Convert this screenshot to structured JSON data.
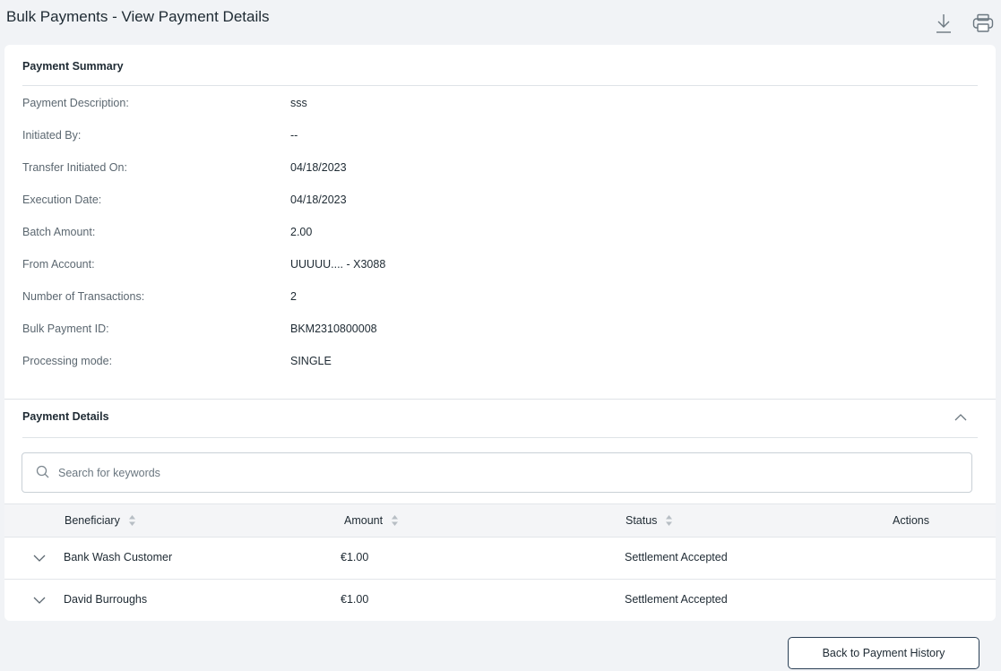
{
  "page": {
    "title": "Bulk Payments - View Payment Details",
    "icons": {
      "download": "download-icon",
      "print": "print-icon"
    }
  },
  "summary": {
    "title": "Payment Summary",
    "rows": [
      {
        "label": "Payment Description:",
        "value": "sss"
      },
      {
        "label": "Initiated By:",
        "value": "--"
      },
      {
        "label": "Transfer Initiated On:",
        "value": "04/18/2023"
      },
      {
        "label": "Execution Date:",
        "value": "04/18/2023"
      },
      {
        "label": "Batch Amount:",
        "value": "2.00"
      },
      {
        "label": "From Account:",
        "value": "UUUUU.... - X3088"
      },
      {
        "label": "Number of Transactions:",
        "value": "2"
      },
      {
        "label": "Bulk Payment ID:",
        "value": "BKM2310800008"
      },
      {
        "label": "Processing mode:",
        "value": "SINGLE"
      }
    ]
  },
  "details": {
    "title": "Payment Details",
    "search": {
      "placeholder": "Search for keywords",
      "value": ""
    },
    "columns": {
      "beneficiary": "Beneficiary",
      "amount": "Amount",
      "status": "Status",
      "actions": "Actions"
    },
    "rows": [
      {
        "beneficiary": "Bank Wash Customer",
        "amount": "€1.00",
        "status": "Settlement Accepted"
      },
      {
        "beneficiary": "David Burroughs",
        "amount": "€1.00",
        "status": "Settlement Accepted"
      }
    ]
  },
  "footer": {
    "back_label": "Back to Payment History"
  },
  "colors": {
    "background": "#f1f3f6",
    "card": "#ffffff",
    "button_border": "#2a3f55",
    "accent": "#2bb3a3"
  }
}
